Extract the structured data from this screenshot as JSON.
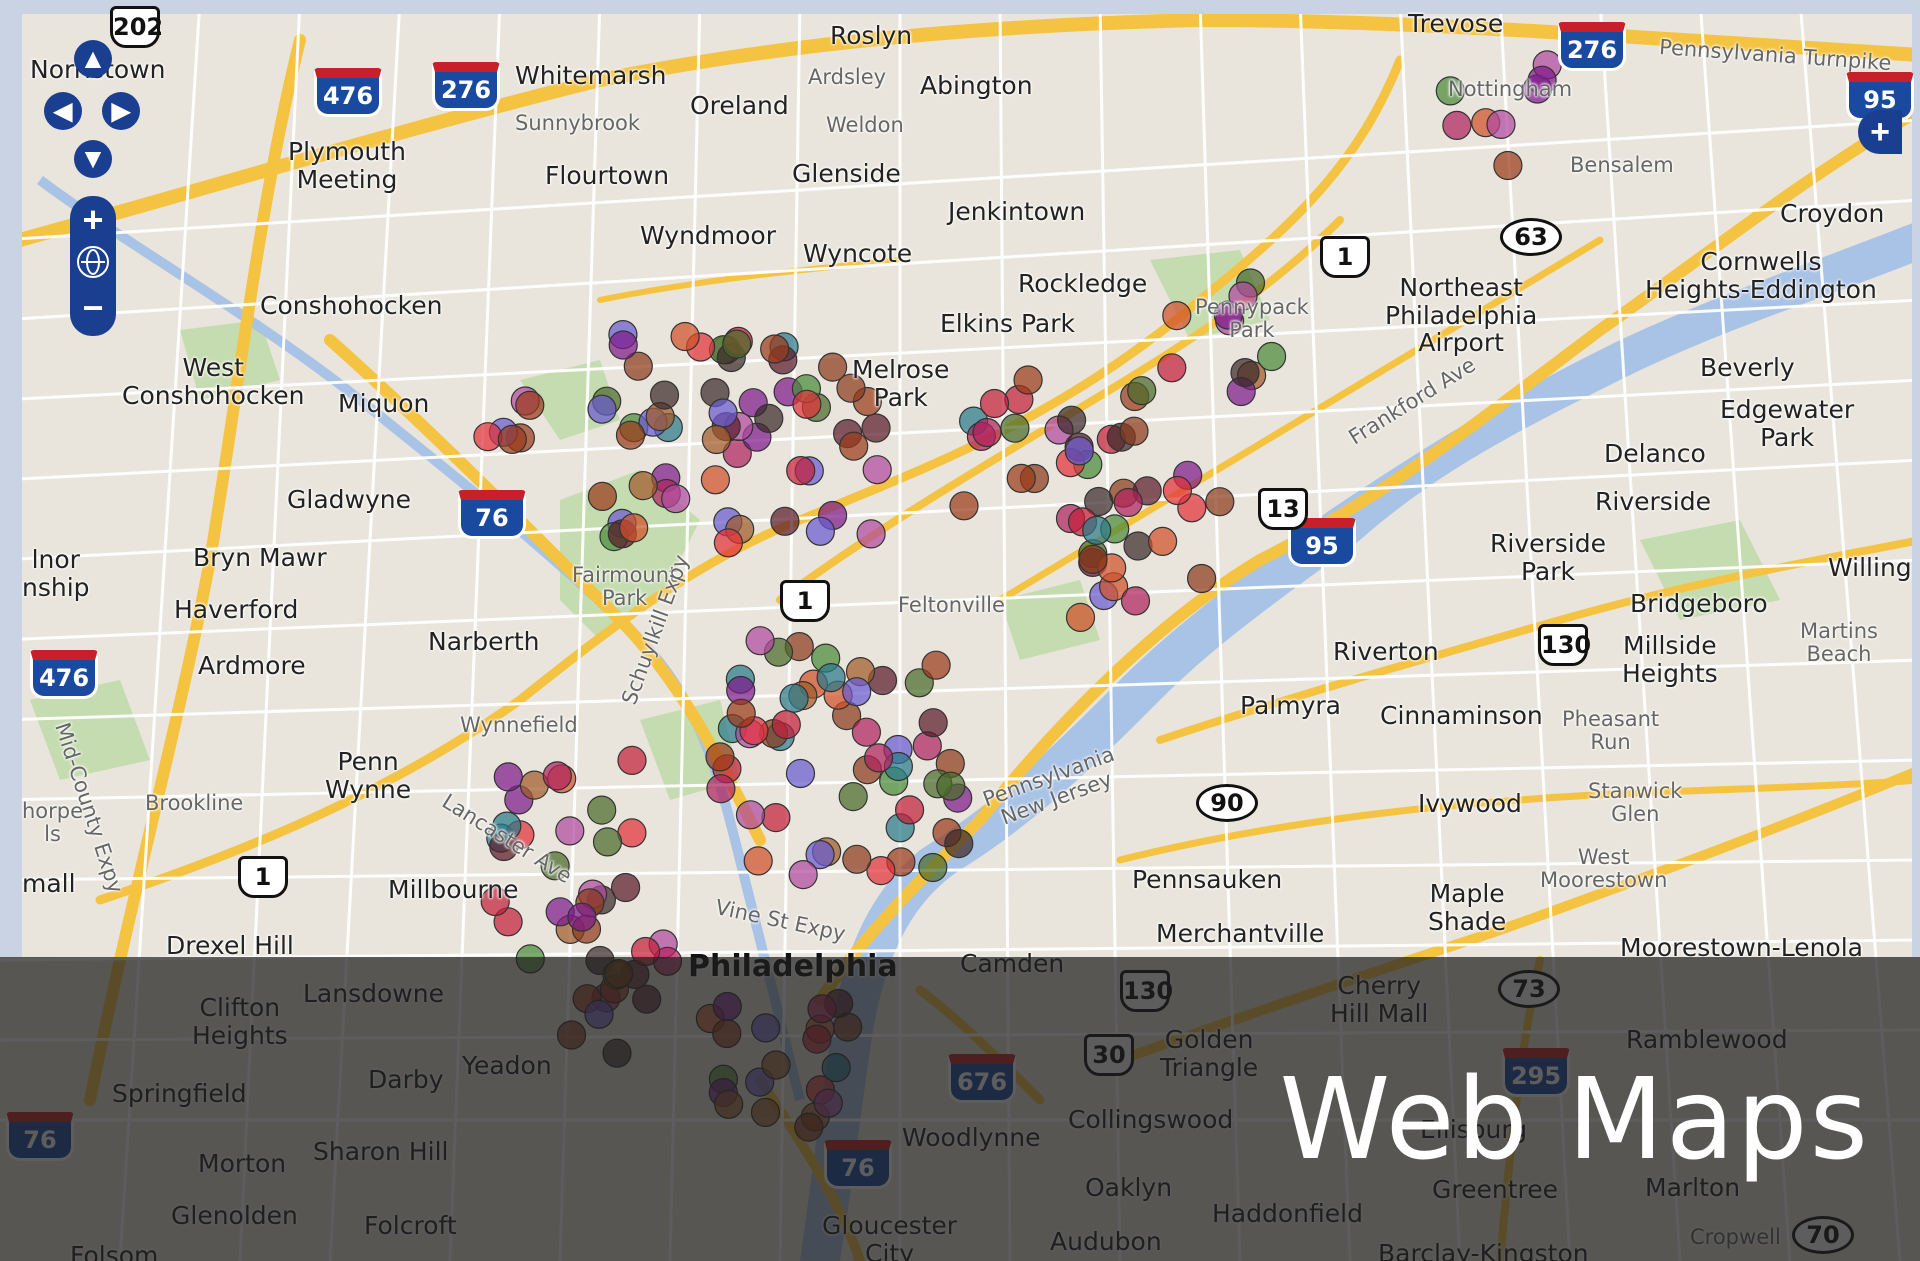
{
  "caption": "Web Maps",
  "controls": {
    "pan_up": "▲",
    "pan_left": "◀",
    "pan_right": "▶",
    "pan_down": "▼",
    "zoom_in": "+",
    "zoom_out": "−",
    "layer_switch": "+"
  },
  "colors": {
    "land": "#e9e5dc",
    "park": "#c5dcb0",
    "water": "#a9c3e6",
    "highway": "#f5c342",
    "road": "#ffffff",
    "control_blue": "#1a3f91",
    "overlay": "#1e1e1e"
  },
  "places": [
    {
      "key": "roslyn",
      "text": "Roslyn"
    },
    {
      "key": "whitemarsh",
      "text": "Whitemarsh"
    },
    {
      "key": "ardsley",
      "text": "Ardsley"
    },
    {
      "key": "abington",
      "text": "Abington"
    },
    {
      "key": "trevose",
      "text": "Trevose"
    },
    {
      "key": "nottingham",
      "text": "Nottingham"
    },
    {
      "key": "pennsylvania_turnpike",
      "text": "Pennsylvania Turnpike"
    },
    {
      "key": "norristown",
      "text": "Norristown"
    },
    {
      "key": "sunnybrook",
      "text": "Sunnybrook"
    },
    {
      "key": "oreland",
      "text": "Oreland"
    },
    {
      "key": "weldon",
      "text": "Weldon"
    },
    {
      "key": "plymouth_meeting",
      "text": "Plymouth\nMeeting"
    },
    {
      "key": "flourtown",
      "text": "Flourtown"
    },
    {
      "key": "glenside",
      "text": "Glenside"
    },
    {
      "key": "bensalem",
      "text": "Bensalem"
    },
    {
      "key": "jenkintown",
      "text": "Jenkintown"
    },
    {
      "key": "croydon",
      "text": "Croydon"
    },
    {
      "key": "wyndmoor",
      "text": "Wyndmoor"
    },
    {
      "key": "wyncote",
      "text": "Wyncote"
    },
    {
      "key": "cornwells",
      "text": "Cornwells\nHeights-Eddington"
    },
    {
      "key": "conshohocken",
      "text": "Conshohocken"
    },
    {
      "key": "rockledge",
      "text": "Rockledge"
    },
    {
      "key": "northeast_airport",
      "text": "Northeast\nPhiladelphia\nAirport"
    },
    {
      "key": "elkins_park",
      "text": "Elkins Park"
    },
    {
      "key": "pennypack_park",
      "text": "Pennypack\nPark"
    },
    {
      "key": "west_conshohocken",
      "text": "West\nConshohocken"
    },
    {
      "key": "miquon",
      "text": "Miquon"
    },
    {
      "key": "melrose_park",
      "text": "Melrose\nPark"
    },
    {
      "key": "beverly",
      "text": "Beverly"
    },
    {
      "key": "edgewater_park",
      "text": "Edgewater\nPark"
    },
    {
      "key": "delanco",
      "text": "Delanco"
    },
    {
      "key": "frankford_ave",
      "text": "Frankford Ave"
    },
    {
      "key": "gladwyne",
      "text": "Gladwyne"
    },
    {
      "key": "riverside",
      "text": "Riverside"
    },
    {
      "key": "bryn_mawr",
      "text": "Bryn Mawr"
    },
    {
      "key": "riverside_park",
      "text": "Riverside\nPark"
    },
    {
      "key": "willing",
      "text": "Willing"
    },
    {
      "key": "fairmount_park",
      "text": "Fairmount\nPark"
    },
    {
      "key": "feltonville",
      "text": "Feltonville"
    },
    {
      "key": "haverford",
      "text": "Haverford"
    },
    {
      "key": "bridgeboro",
      "text": "Bridgeboro"
    },
    {
      "key": "martins_beach",
      "text": "Martins\nBeach"
    },
    {
      "key": "narberth",
      "text": "Narberth"
    },
    {
      "key": "riverton",
      "text": "Riverton"
    },
    {
      "key": "millside_heights",
      "text": "Millside\nHeights"
    },
    {
      "key": "ardmore",
      "text": "Ardmore"
    },
    {
      "key": "palmyra",
      "text": "Palmyra"
    },
    {
      "key": "cinnaminson",
      "text": "Cinnaminson"
    },
    {
      "key": "pheasant_run",
      "text": "Pheasant\nRun"
    },
    {
      "key": "wynnefield",
      "text": "Wynnefield"
    },
    {
      "key": "penn_wynne",
      "text": "Penn\nWynne"
    },
    {
      "key": "brookline",
      "text": "Brookline"
    },
    {
      "key": "stanwick_glen",
      "text": "Stanwick\nGlen"
    },
    {
      "key": "ivywood",
      "text": "Ivywood"
    },
    {
      "key": "pennsylvania_nj",
      "text": "Pennsylvania\nNew Jersey"
    },
    {
      "key": "west_moorestown",
      "text": "West\nMoorestown"
    },
    {
      "key": "millbourne",
      "text": "Millbourne"
    },
    {
      "key": "pennsauken",
      "text": "Pennsauken"
    },
    {
      "key": "maple_shade",
      "text": "Maple\nShade"
    },
    {
      "key": "drexel_hill",
      "text": "Drexel Hill"
    },
    {
      "key": "merchantville",
      "text": "Merchantville"
    },
    {
      "key": "moorestown_lenola",
      "text": "Moorestown-Lenola"
    },
    {
      "key": "philadelphia",
      "text": "Philadelphia"
    },
    {
      "key": "camden",
      "text": "Camden"
    },
    {
      "key": "clifton_heights",
      "text": "Clifton\nHeights"
    },
    {
      "key": "lansdowne",
      "text": "Lansdowne"
    },
    {
      "key": "cherry_hill_mall",
      "text": "Cherry\nHill Mall"
    },
    {
      "key": "ramblewood",
      "text": "Ramblewood"
    },
    {
      "key": "springfield",
      "text": "Springfield"
    },
    {
      "key": "darby",
      "text": "Darby"
    },
    {
      "key": "yeadon",
      "text": "Yeadon"
    },
    {
      "key": "golden_triangle",
      "text": "Golden\nTriangle"
    },
    {
      "key": "morton",
      "text": "Morton"
    },
    {
      "key": "sharon_hill",
      "text": "Sharon Hill"
    },
    {
      "key": "collingswood",
      "text": "Collingswood"
    },
    {
      "key": "woodlynne",
      "text": "Woodlynne"
    },
    {
      "key": "ellisburg",
      "text": "Ellisburg"
    },
    {
      "key": "glenolden",
      "text": "Glenolden"
    },
    {
      "key": "folcroft",
      "text": "Folcroft"
    },
    {
      "key": "oaklyn",
      "text": "Oaklyn"
    },
    {
      "key": "greentree",
      "text": "Greentree"
    },
    {
      "key": "marlton",
      "text": "Marlton"
    },
    {
      "key": "gloucester_city",
      "text": "Gloucester\nCity"
    },
    {
      "key": "haddonfield",
      "text": "Haddonfield"
    },
    {
      "key": "audubon",
      "text": "Audubon"
    },
    {
      "key": "folsom",
      "text": "Folsom"
    },
    {
      "key": "barclay_kingston",
      "text": "Barclay-Kingston"
    },
    {
      "key": "cropwell",
      "text": "Cropwell"
    },
    {
      "key": "lancaster_ave",
      "text": "Lancaster Ave"
    },
    {
      "key": "schuylkill_expy",
      "text": "Schuylkill Expy"
    },
    {
      "key": "vine_st_expy",
      "text": "Vine St Expy"
    },
    {
      "key": "mid_county_expy",
      "text": "Mid-County Expy"
    },
    {
      "key": "lnor",
      "text": "lnor\nnship"
    },
    {
      "key": "thorpe",
      "text": "horpe\nls"
    },
    {
      "key": "mall",
      "text": "mall"
    }
  ],
  "shields": [
    {
      "key": "i476a",
      "type": "interstate",
      "text": "476"
    },
    {
      "key": "i276a",
      "type": "interstate",
      "text": "276"
    },
    {
      "key": "i276b",
      "type": "interstate",
      "text": "276"
    },
    {
      "key": "i95a",
      "type": "interstate",
      "text": "95"
    },
    {
      "key": "i76a",
      "type": "interstate",
      "text": "76"
    },
    {
      "key": "i95b",
      "type": "interstate",
      "text": "95"
    },
    {
      "key": "i476b",
      "type": "interstate",
      "text": "476"
    },
    {
      "key": "i676",
      "type": "interstate",
      "text": "676"
    },
    {
      "key": "i76b",
      "type": "interstate",
      "text": "76"
    },
    {
      "key": "i295",
      "type": "interstate",
      "text": "295"
    },
    {
      "key": "i76c",
      "type": "interstate",
      "text": "76"
    },
    {
      "key": "us1a",
      "type": "us",
      "text": "1"
    },
    {
      "key": "us1b",
      "type": "us",
      "text": "1"
    },
    {
      "key": "us1c",
      "type": "us",
      "text": "1"
    },
    {
      "key": "us13",
      "type": "us",
      "text": "13"
    },
    {
      "key": "us130a",
      "type": "us",
      "text": "130"
    },
    {
      "key": "us130b",
      "type": "us",
      "text": "130"
    },
    {
      "key": "us30",
      "type": "us",
      "text": "30"
    },
    {
      "key": "us202",
      "type": "us",
      "text": "202"
    },
    {
      "key": "pa63",
      "type": "state",
      "text": "63"
    },
    {
      "key": "nj90",
      "type": "state",
      "text": "90"
    },
    {
      "key": "nj73",
      "type": "state",
      "text": "73"
    },
    {
      "key": "nj70",
      "type": "state",
      "text": "70"
    }
  ],
  "marker_colors": [
    "#8b3a1c",
    "#b0235e",
    "#7d1a8a",
    "#5a1a2a",
    "#c21e3a",
    "#4a6b2a",
    "#9a3a1a",
    "#2a7a8a",
    "#6a5ad0",
    "#d0502a",
    "#a05a2a",
    "#3a2a2a",
    "#b04aa0",
    "#e0303a",
    "#4a8a3a"
  ]
}
